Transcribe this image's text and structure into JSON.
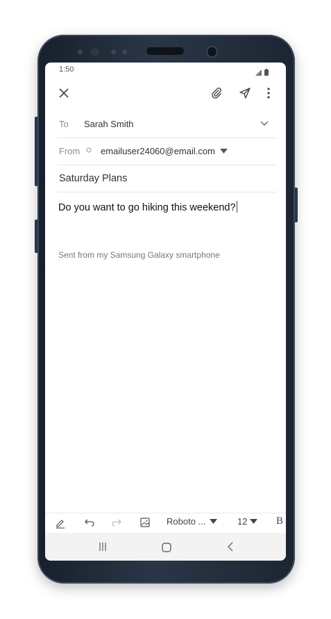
{
  "status_bar": {
    "time": "1:50"
  },
  "email": {
    "to_label": "To",
    "to_value": "Sarah Smith",
    "from_label": "From",
    "from_value": "emailuser24060@email.com",
    "subject": "Saturday Plans",
    "body": "Do you want to go hiking this weekend?",
    "signature": "Sent from my Samsung Galaxy smartphone"
  },
  "toolbar": {
    "font_name": "Roboto ...",
    "font_size": "12",
    "bold_label": "B"
  },
  "icons": [
    "close-icon",
    "paperclip-icon",
    "send-icon",
    "more-vert-icon",
    "chevron-down-icon",
    "caret-down-icon",
    "pen-icon",
    "undo-icon",
    "redo-icon",
    "image-icon",
    "recent-apps-icon",
    "home-icon",
    "back-icon"
  ],
  "colors": {
    "phone_body": "#1f2a3a",
    "accent_text": "#333333",
    "muted_text": "#8c8c8c"
  }
}
